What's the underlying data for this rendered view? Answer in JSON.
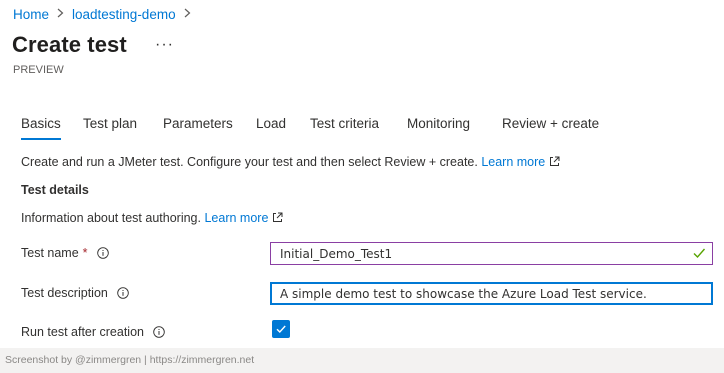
{
  "breadcrumb": {
    "items": [
      "Home",
      "loadtesting-demo"
    ]
  },
  "page": {
    "title": "Create test",
    "more_label": "···",
    "subtitle": "PREVIEW"
  },
  "tabs": [
    {
      "label": "Basics",
      "active": true
    },
    {
      "label": "Test plan"
    },
    {
      "label": "Parameters"
    },
    {
      "label": "Load"
    },
    {
      "label": "Test criteria"
    },
    {
      "label": "Monitoring"
    },
    {
      "label": "Review + create"
    }
  ],
  "intro": {
    "text": "Create and run a JMeter test. Configure your test and then select Review + create.",
    "link": "Learn more"
  },
  "section": {
    "title": "Test details",
    "info_text": "Information about test authoring.",
    "info_link": "Learn more"
  },
  "fields": {
    "test_name": {
      "label": "Test name",
      "required_marker": "*",
      "value": "Initial_Demo_Test1"
    },
    "test_description": {
      "label": "Test description",
      "value": "A simple demo test to showcase the Azure Load Test service."
    },
    "run_after_creation": {
      "label": "Run test after creation",
      "checked": true
    }
  },
  "footer": {
    "text": "Screenshot by @zimmergren | https://zimmergren.net"
  },
  "colors": {
    "accent": "#0078d4",
    "required": "#a4262c",
    "valid": "#57a300",
    "name_border": "#8a3fa3"
  }
}
